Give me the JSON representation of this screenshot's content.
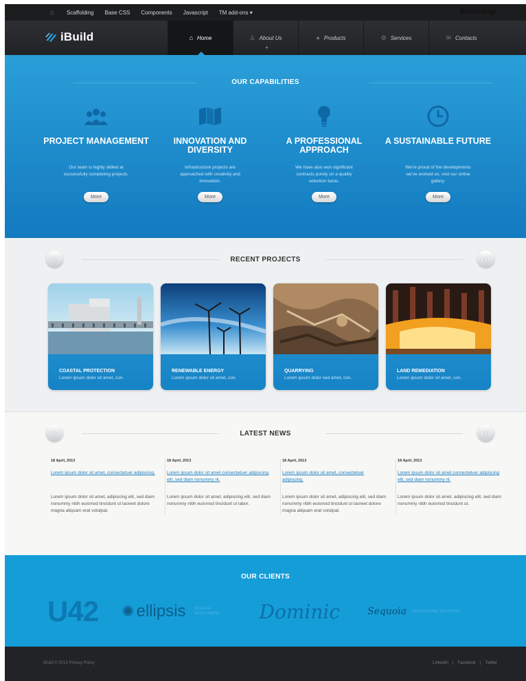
{
  "topbar": {
    "items": [
      "Scaffolding",
      "Base CSS",
      "Components",
      "Javascript",
      "TM add-ons"
    ],
    "addons_caret": "▾",
    "brand": "Bootstrap"
  },
  "header": {
    "logo": "iBuild",
    "nav": [
      {
        "label": "Home",
        "icon": "home-icon",
        "active": true
      },
      {
        "label": "About Us",
        "icon": "user-icon",
        "active": false
      },
      {
        "label": "Products",
        "icon": "circle-icon",
        "active": false
      },
      {
        "label": "Services",
        "icon": "gear-icon",
        "active": false
      },
      {
        "label": "Contacts",
        "icon": "chat-icon",
        "active": false
      }
    ]
  },
  "capabilities": {
    "title": "OUR CAPABILITIES",
    "items": [
      {
        "title": "PROJECT MANAGEMENT",
        "text": "Our team is highly skilled at successfully completing projects.",
        "button": "More",
        "icon": "people-icon"
      },
      {
        "title": "INNOVATION AND DIVERSITY",
        "text": "Infrastructure projects are approached with creativity and innovation.",
        "button": "More",
        "icon": "map-icon"
      },
      {
        "title": "A PROFESSIONAL APPROACH",
        "text": "We have also won significant contracts purely on a quality selection basis.",
        "button": "More",
        "icon": "bulb-icon"
      },
      {
        "title": "A SUSTAINABLE FUTURE",
        "text": "We're proud of the developments we've worked on, visit our online gallery.",
        "button": "More",
        "icon": "clock-icon"
      }
    ]
  },
  "projects": {
    "title": "RECENT PROJECTS",
    "items": [
      {
        "title": "COASTAL PROTECTION",
        "text": "Lorem ipsum dolor sit amet, con."
      },
      {
        "title": "RENEWABLE ENERGY",
        "text": "Lorem ipsum dolor sit amet, con."
      },
      {
        "title": "QUARRYING",
        "text": "Lorem ipsum dolor sed amet, con."
      },
      {
        "title": "LAND REMEDIATION",
        "text": "Lorem ipsum dolor sit amet, con."
      }
    ]
  },
  "news": {
    "title": "LATEST NEWS",
    "items": [
      {
        "date": "18 April, 2013",
        "link": "Lorem ipsum dolor sit amet, consectetuer adipiscing.",
        "text": "Lorem ipsum dolor sit amet, adipiscing elit, sed diam nonummy nibh euismod tincidunt ut laoreet dolore magna aliquam erat volutpat."
      },
      {
        "date": "18 April, 2013",
        "link": "Lorem ipsum dolor sit amet consectetuer adipiscing elit, sed diam nonummy nl.",
        "text": "Lorem ipsum dolor sit amet, adipiscing elit, sed diam nonummy nibh euismod tincidunt ut labor."
      },
      {
        "date": "18 April, 2013",
        "link": "Lorem ipsum dolor sit amet, consectetuer adipiscing.",
        "text": "Lorem ipsum dolor sit amet, adipiscing elit, sed diam nonummy nibh euismod tincidunt ut laoreet dolore magna aliquam erat volutpat."
      },
      {
        "date": "18 April, 2013",
        "link": "Lorem ipsum dolor sit amet consectetuer adipiscing elit, sed diam nonummy nl.",
        "text": "Lorem ipsum dolor sit amet, adipiscing elit, sed diam nonummy nibh euismod tincidunt ut."
      }
    ]
  },
  "clients": {
    "title": "OUR CLIENTS",
    "logos": {
      "u42": "U42",
      "ellipsis": "ellipsis",
      "ellipsis_sub": "DESIGN & DEVELOPMENT",
      "dominic": "Dominic",
      "sequoia": "Sequoia",
      "sequoia_sub": "PROFESSIONAL SOLUTIONS"
    }
  },
  "footer": {
    "copyright": "iBuild © 2013 Privacy Policy",
    "social": [
      "LinkedIn",
      "|",
      "Facebook",
      "|",
      "Twitter"
    ]
  },
  "colors": {
    "accent": "#1a8fd0",
    "dark": "#222326",
    "light": "#eef0f1"
  }
}
